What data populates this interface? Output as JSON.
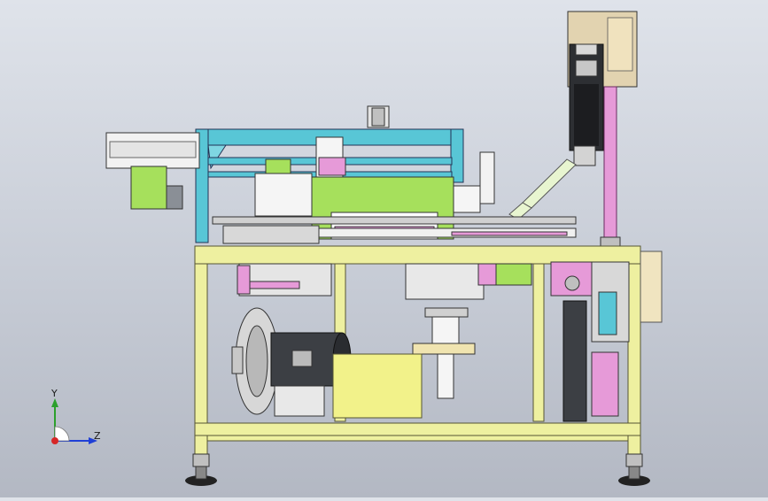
{
  "viewport": {
    "background_top": "#dfe3ea",
    "background_bottom": "#b3b8c3"
  },
  "triad": {
    "y_label": "Y",
    "z_label": "Z",
    "y_color": "#2ca02c",
    "z_color": "#1f3fd6",
    "x_color": "#d62728"
  },
  "colors": {
    "frame_yellow": "#eef0a0",
    "frame_stroke": "#555533",
    "cyan_frame": "#58c6d6",
    "lime_block": "#a6e05c",
    "pink_accent": "#e69ad8",
    "motor_gray": "#8a8f96",
    "dark_gray": "#3c3f44",
    "tan_box": "#e2d3b0"
  },
  "icons": [
    "coordinate-triad-icon",
    "motor-icon",
    "blower-icon",
    "pillar-icon"
  ]
}
